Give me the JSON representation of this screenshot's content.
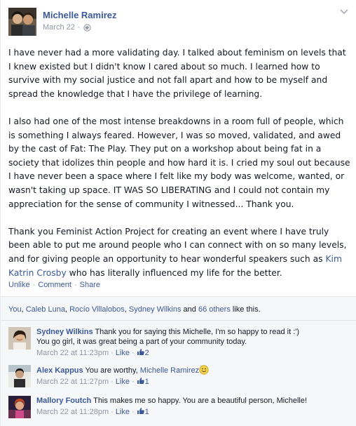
{
  "post": {
    "author": "Michelle Ramirez",
    "time": "March 22",
    "paragraphs": [
      "I have never had a more validating day. I talked about feminism on levels that I knew existed but I didn't know I cared about so much. I learned how to survive with my social justice and not fall apart and how to be myself and spread the knowledge that I have the privilege of learning.",
      "I also had one of the most intense breakdowns in a room full of people, which is something I always feared. However, I was so moved, validated, and awed by the cast of Fat: The Play. They put on a workshop about being fat in a society that idolizes thin people and how hard it is. I cried my soul out because I have never been a space where I felt like my body was welcome, wanted, or wasn't taking up space. IT WAS SO LIBERATING and I could not contain my appreciation for the sense of community I witnessed... Thank you."
    ],
    "p3_before": "Thank you Feminist Action Project for creating an event where I have truly been able to put me around people who I can connect with on so many levels, and for giving people an opportunity to hear wonderful speakers such as ",
    "p3_link": "Kim Katrin Crosby",
    "p3_after": " who has literally influenced my life for the better."
  },
  "actions": {
    "unlike": "Unlike",
    "comment": "Comment",
    "share": "Share",
    "sep": "·"
  },
  "likes": {
    "you": "You",
    "names": [
      "Caleb Luna",
      "Rocío Villalobos",
      "Sydney Wilkins"
    ],
    "and": "and",
    "others": "66 others",
    "tail": "like this."
  },
  "comments": [
    {
      "name": "Sydney Wilkins",
      "text": "Thank you for saying this Michelle, I'm so happy to read it :')",
      "text2": "You go girl, it was great being a part of your community today.",
      "time": "March 22 at 11:23pm",
      "like": "Like",
      "count": "2"
    },
    {
      "name": "Alex Kappus",
      "text": "You are worthy,",
      "mention": "Michelle Ramirez",
      "time": "March 22 at 11:27pm",
      "like": "Like",
      "count": "1"
    },
    {
      "name": "Mallory Foutch",
      "text": "This makes me so happy. You are a beautiful person, Michelle!",
      "time": "March 22 at 11:28pm",
      "like": "Like",
      "count": "1"
    }
  ],
  "colors": {
    "link": "#3b5998",
    "meta": "#9197a3",
    "ufi_bg": "#f6f7f8"
  },
  "icons": [
    "globe-icon",
    "chevron-down-icon",
    "thumbs-up-icon",
    "smiley-icon"
  ]
}
